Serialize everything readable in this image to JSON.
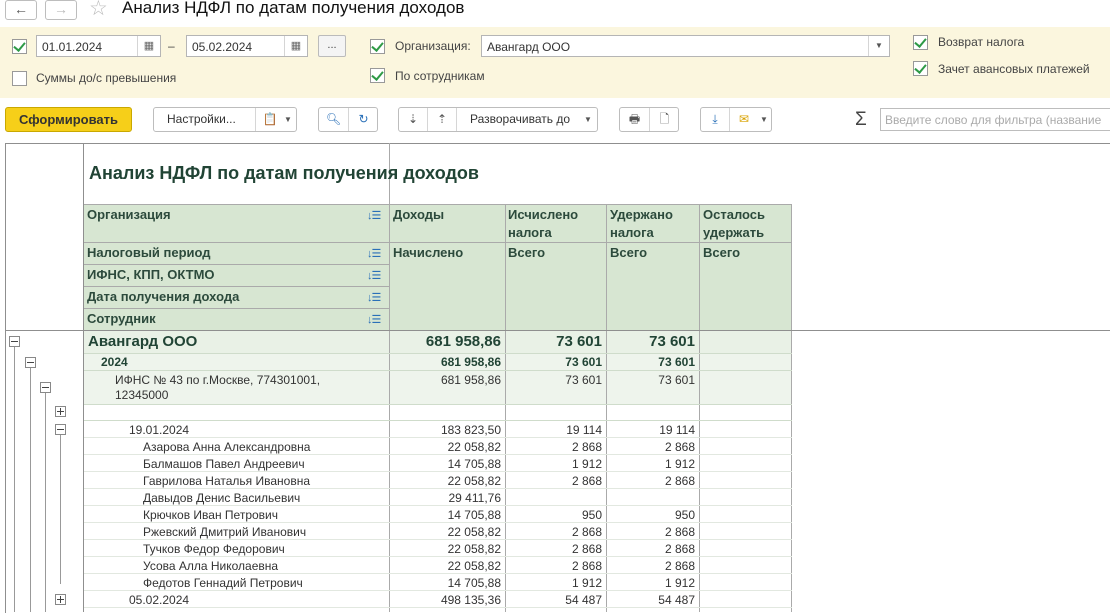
{
  "window": {
    "title": "Анализ НДФЛ по датам получения доходов",
    "back_icon": "←",
    "forward_icon": "→",
    "star_icon": "☆"
  },
  "params": {
    "period_enabled": true,
    "date_from": "01.01.2024",
    "dash": "–",
    "date_to": "05.02.2024",
    "dots_label": "...",
    "org_enabled": true,
    "org_label": "Организация:",
    "org_value": "Авангард ООО",
    "by_employees_enabled": true,
    "by_employees_label": "По сотрудникам",
    "excess_enabled": false,
    "excess_label": "Суммы до/с превышения",
    "refund_enabled": true,
    "refund_label": "Возврат налога",
    "advance_enabled": true,
    "advance_label": "Зачет авансовых платежей"
  },
  "toolbar": {
    "generate_label": "Сформировать",
    "settings_label": "Настройки...",
    "expand_label": "Разворачивать до",
    "filter_placeholder": "Введите слово для фильтра (название",
    "sigma": "Σ"
  },
  "report": {
    "title": "Анализ НДФЛ по датам получения доходов",
    "group_headers": [
      "Организация",
      "Налоговый период",
      "ИФНС, КПП, ОКТМО",
      "Дата получения дохода",
      "Сотрудник"
    ],
    "col_headers": {
      "income": "Доходы",
      "calculated": "Исчислено налога",
      "withheld": "Удержано налога",
      "remaining": "Осталось удержать",
      "income_sub": "Начислено",
      "calculated_sub": "Всего",
      "withheld_sub": "Всего",
      "remaining_sub": "Всего"
    },
    "org_row": {
      "name": "Авангард ООО",
      "income": "681 958,86",
      "calculated": "73 601",
      "withheld": "73 601"
    },
    "period_row": {
      "name": "2024",
      "income": "681 958,86",
      "calculated": "73 601",
      "withheld": "73 601"
    },
    "ifns_row": {
      "name_line1": "ИФНС № 43 по г.Москве, 774301001,",
      "name_line2": "12345000",
      "income": "681 958,86",
      "calculated": "73 601",
      "withheld": "73 601"
    },
    "date1_row": {
      "name": "19.01.2024",
      "income": "183 823,50",
      "calculated": "19 114",
      "withheld": "19 114"
    },
    "employees": [
      {
        "name": "Азарова Анна Александровна",
        "income": "22 058,82",
        "calculated": "2 868",
        "withheld": "2 868"
      },
      {
        "name": "Балмашов Павел Андреевич",
        "income": "14 705,88",
        "calculated": "1 912",
        "withheld": "1 912"
      },
      {
        "name": "Гаврилова Наталья Ивановна",
        "income": "22 058,82",
        "calculated": "2 868",
        "withheld": "2 868"
      },
      {
        "name": "Давыдов Денис Васильевич",
        "income": "29 411,76",
        "calculated": "",
        "withheld": ""
      },
      {
        "name": "Крючков Иван Петрович",
        "income": "14 705,88",
        "calculated": "950",
        "withheld": "950"
      },
      {
        "name": "Ржевский Дмитрий Иванович",
        "income": "22 058,82",
        "calculated": "2 868",
        "withheld": "2 868"
      },
      {
        "name": "Тучков Федор Федорович",
        "income": "22 058,82",
        "calculated": "2 868",
        "withheld": "2 868"
      },
      {
        "name": "Усова Алла Николаевна",
        "income": "22 058,82",
        "calculated": "2 868",
        "withheld": "2 868"
      },
      {
        "name": "Федотов Геннадий Петрович",
        "income": "14 705,88",
        "calculated": "1 912",
        "withheld": "1 912"
      }
    ],
    "date2_row": {
      "name": "05.02.2024",
      "income": "498 135,36",
      "calculated": "54 487",
      "withheld": "54 487"
    }
  }
}
